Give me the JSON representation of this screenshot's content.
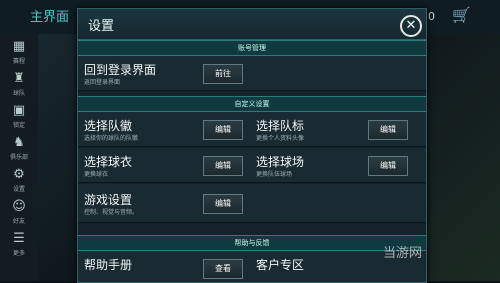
{
  "background": {
    "title": "主界面",
    "sidebar": [
      "赛程",
      "球队",
      "锁定",
      "俱乐部",
      "设置",
      "好友",
      "更多"
    ],
    "coin": "0"
  },
  "dialog": {
    "title": "设置",
    "sections": {
      "account": "账号管理",
      "custom": "自定义设置",
      "help": "帮助与反馈"
    },
    "rows": {
      "login": {
        "label": "回到登录界面",
        "sub": "返回登录界面",
        "button": "前往"
      },
      "crest": {
        "label": "选择队徽",
        "sub": "选择你的球队的队徽",
        "button": "编辑"
      },
      "logo": {
        "label": "选择队标",
        "sub": "更换个人资料头像",
        "button": "编辑"
      },
      "kit": {
        "label": "选择球衣",
        "sub": "更换球衣",
        "button": "编辑"
      },
      "stadium": {
        "label": "选择球场",
        "sub": "更换队伍球场",
        "button": "编辑"
      },
      "game": {
        "label": "游戏设置",
        "sub": "控制、视觉与音频。",
        "button": "编辑"
      },
      "manual": {
        "label": "帮助手册",
        "button": "查看"
      },
      "support": {
        "label": "客户专区"
      }
    }
  },
  "watermark": "当游网"
}
